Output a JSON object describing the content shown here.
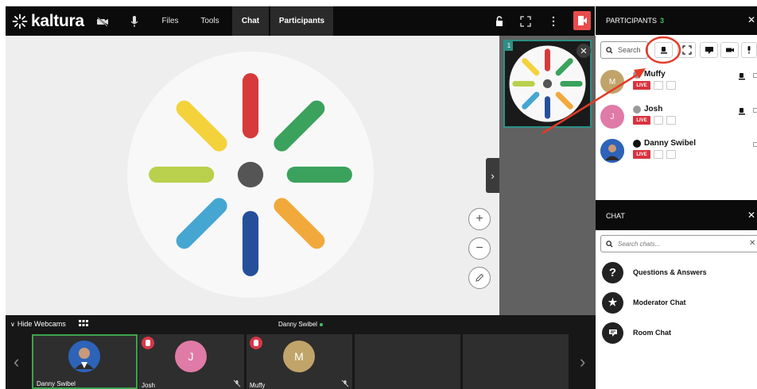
{
  "topbar": {
    "brand": "kaltura",
    "items": [
      {
        "label": "Files"
      },
      {
        "label": "Tools"
      },
      {
        "label": "Chat"
      },
      {
        "label": "Participants"
      }
    ]
  },
  "stage": {
    "thumbnail_number": "1",
    "zoom_in": "+",
    "zoom_out": "−",
    "colors": [
      "#d63a3a",
      "#3aa25c",
      "#3aa25c",
      "#f2a93b",
      "#254f9b",
      "#46a6d2",
      "#b8d04c",
      "#f4d23b"
    ]
  },
  "webcams": {
    "toggle_label": "Hide Webcams",
    "active_speaker": "Danny Swibel",
    "tiles": [
      {
        "name": "Danny Swibel"
      },
      {
        "name": "Josh",
        "initial": "J"
      },
      {
        "name": "Muffy",
        "initial": "M"
      }
    ]
  },
  "participants": {
    "title": "PARTICIPANTS",
    "count": "3",
    "search_placeholder": "Search",
    "rows": [
      {
        "name": "Muffy",
        "initial": "M",
        "live": "LIVE"
      },
      {
        "name": "Josh",
        "initial": "J",
        "live": "LIVE"
      },
      {
        "name": "Danny Swibel",
        "live": "LIVE"
      }
    ]
  },
  "chat": {
    "title": "CHAT",
    "search_placeholder": "Search chats...",
    "items": [
      {
        "label": "Questions & Answers",
        "icon": "?"
      },
      {
        "label": "Moderator Chat",
        "icon": "★"
      },
      {
        "label": "Room Chat",
        "icon": "message-icon"
      }
    ]
  }
}
